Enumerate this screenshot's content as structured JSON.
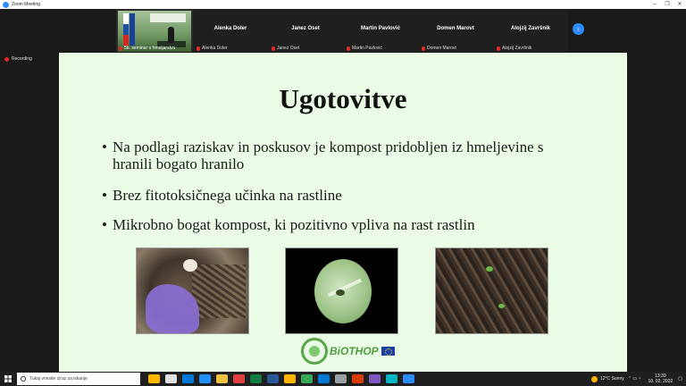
{
  "window": {
    "title": "Zoom Meeting",
    "controls": [
      "–",
      "❐",
      "✕"
    ]
  },
  "gallery": {
    "active_tile_caption": "5b. seminar o hmeljarstvu",
    "participants": [
      {
        "name": "Alenka Doler",
        "label": "Alenka Doler"
      },
      {
        "name": "Janez Oset",
        "label": "Janez Oset"
      },
      {
        "name": "Martin Pavlović",
        "label": "Martin Pavlović"
      },
      {
        "name": "Domen Marovt",
        "label": "Domen Marovt"
      },
      {
        "name": "Alojzij Završnik",
        "label": "Alojzij Završnik"
      }
    ],
    "next_icon": "chevron-right-icon"
  },
  "recording": {
    "label": "Recording"
  },
  "slide": {
    "title": "Ugotovitve",
    "bullets": [
      "Na podlagi raziskav in poskusov je kompost pridobljen iz hmeljevine s hranili bogato hranilo",
      "Brez fitotoksičnega učinka na rastline",
      "Mikrobno bogat kompost, ki pozitivno vpliva na rast rastlin"
    ],
    "bullet_char": "•",
    "logo_text": "BiOTHOP"
  },
  "taskbar": {
    "search_placeholder": "Tukaj vnesite izraz za iskanje",
    "weather": "12°C  Sunny",
    "time": "13:30",
    "date": "10. 02. 2022",
    "app_colors": [
      "#ffb400",
      "#e0e0e0",
      "#0078d7",
      "#1e90ff",
      "#f0c040",
      "#e04040",
      "#107c41",
      "#2b579a",
      "#ffb400",
      "#34a853",
      "#0078d7",
      "#9aa0a6",
      "#d83b01",
      "#7e57c2",
      "#00b7c3",
      "#2d8cff"
    ]
  }
}
